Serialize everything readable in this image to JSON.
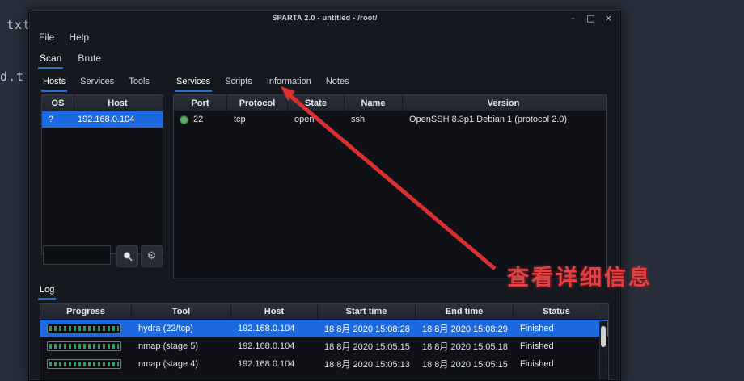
{
  "desktop": {
    "bg_text_top": "txt",
    "bg_text_mid": "d.t"
  },
  "window": {
    "title": "SPARTA 2.0 - untitled - /root/",
    "controls": {
      "minimize": "–",
      "maximize": "□",
      "close": "×"
    },
    "menu": [
      "File",
      "Help"
    ],
    "main_tabs": [
      "Scan",
      "Brute"
    ]
  },
  "hosts_panel": {
    "tabs": [
      "Hosts",
      "Services",
      "Tools"
    ],
    "headers": [
      "OS",
      "Host"
    ],
    "rows": [
      {
        "os": "?",
        "host": "192.168.0.104"
      }
    ],
    "filter": {
      "value": "",
      "placeholder": ""
    },
    "icons": {
      "search": "search-icon",
      "gear": "⚙"
    }
  },
  "services_panel": {
    "tabs": [
      "Services",
      "Scripts",
      "Information",
      "Notes"
    ],
    "headers": [
      "Port",
      "Protocol",
      "State",
      "Name",
      "Version"
    ],
    "rows": [
      {
        "port": "22",
        "protocol": "tcp",
        "state": "open",
        "name": "ssh",
        "version": "OpenSSH 8.3p1 Debian 1 (protocol 2.0)"
      }
    ]
  },
  "log_panel": {
    "tab": "Log",
    "headers": [
      "Progress",
      "Tool",
      "Host",
      "Start time",
      "End time",
      "Status"
    ],
    "rows": [
      {
        "tool": "hydra (22/tcp)",
        "host": "192.168.0.104",
        "start": "18 8月 2020 15:08:28",
        "end": "18 8月 2020 15:08:29",
        "status": "Finished",
        "progress_percent": 100,
        "selected": true
      },
      {
        "tool": "nmap (stage 5)",
        "host": "192.168.0.104",
        "start": "18 8月 2020 15:05:15",
        "end": "18 8月 2020 15:05:18",
        "status": "Finished",
        "progress_percent": 100,
        "selected": false
      },
      {
        "tool": "nmap (stage 4)",
        "host": "192.168.0.104",
        "start": "18 8月 2020 15:05:13",
        "end": "18 8月 2020 15:05:15",
        "status": "Finished",
        "progress_percent": 100,
        "selected": false
      }
    ]
  },
  "annotation": {
    "text": "查看详细信息"
  },
  "colors": {
    "selection_blue": "#1d6ae0",
    "tab_underline_blue": "#2e6bd4",
    "open_state_green": "#5fa865",
    "progress_green": "#2f9e57",
    "annotation_red": "#e14246",
    "desktop_background": "#272e3a",
    "window_background": "#16181f"
  }
}
